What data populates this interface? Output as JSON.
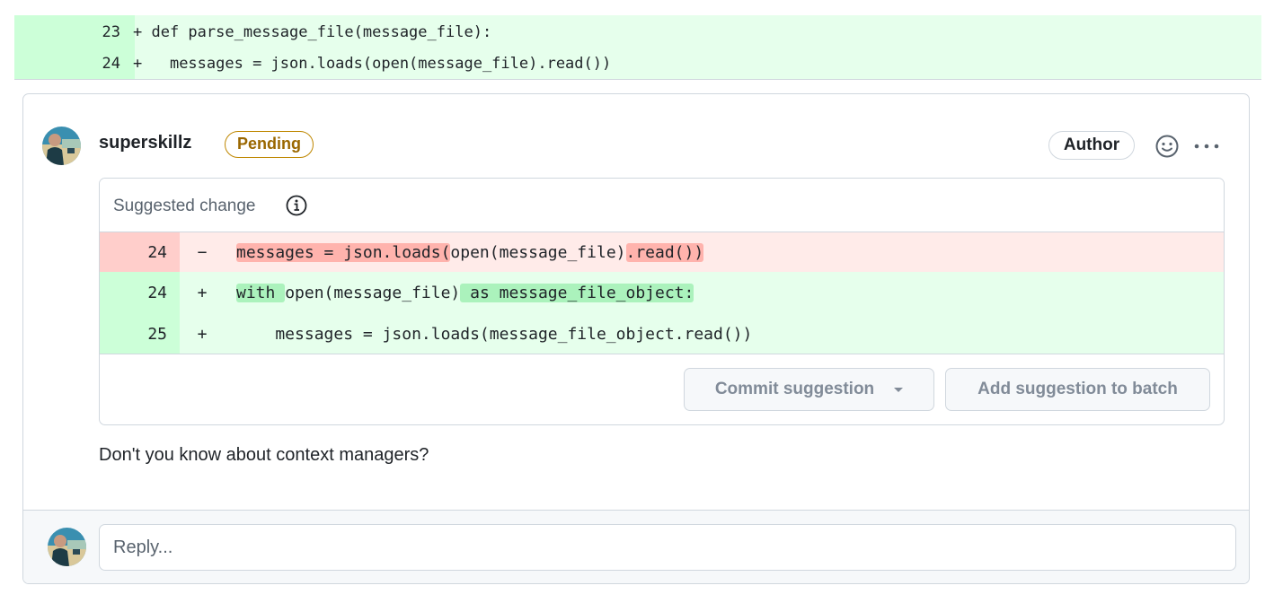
{
  "top_diff": {
    "lines": [
      {
        "number": "23",
        "sign": "+",
        "code": " def parse_message_file(message_file):"
      },
      {
        "number": "24",
        "sign": "+",
        "code": "   messages = json.loads(open(message_file).read())"
      }
    ]
  },
  "comment": {
    "author": "superskillz",
    "status_badge": "Pending",
    "role_badge": "Author",
    "reaction_icon": "smiley-icon",
    "menu_icon": "kebab-horizontal-icon",
    "suggestion": {
      "title": "Suggested change",
      "info_icon": "info-icon",
      "deleted": {
        "number": "24",
        "sign": "−",
        "segments": [
          {
            "text": "messages = json.loads(",
            "highlight": true
          },
          {
            "text": "open(message_file)",
            "highlight": false
          },
          {
            "text": ".read())",
            "highlight": true
          }
        ]
      },
      "added": [
        {
          "number": "24",
          "sign": "+",
          "segments": [
            {
              "text": "with ",
              "highlight": true
            },
            {
              "text": "open(message_file)",
              "highlight": false
            },
            {
              "text": " as message_file_object:",
              "highlight": true
            }
          ]
        },
        {
          "number": "25",
          "sign": "+",
          "segments": [
            {
              "text": "    messages = json.loads(message_file_object.read())",
              "highlight": false
            }
          ]
        }
      ],
      "commit_button": "Commit suggestion",
      "batch_button": "Add suggestion to batch"
    },
    "body": "Don't you know about context managers?",
    "reply": {
      "placeholder": "Reply...",
      "value": ""
    }
  },
  "colors": {
    "added_bg": "#e6ffec",
    "added_gutter": "#ccffd8",
    "added_highlight": "#abf2bc",
    "deleted_bg": "#ffebe9",
    "deleted_gutter": "#ffcecb",
    "deleted_highlight": "#ffb3ad",
    "pending": "#9a6700",
    "border": "#d0d7de"
  }
}
